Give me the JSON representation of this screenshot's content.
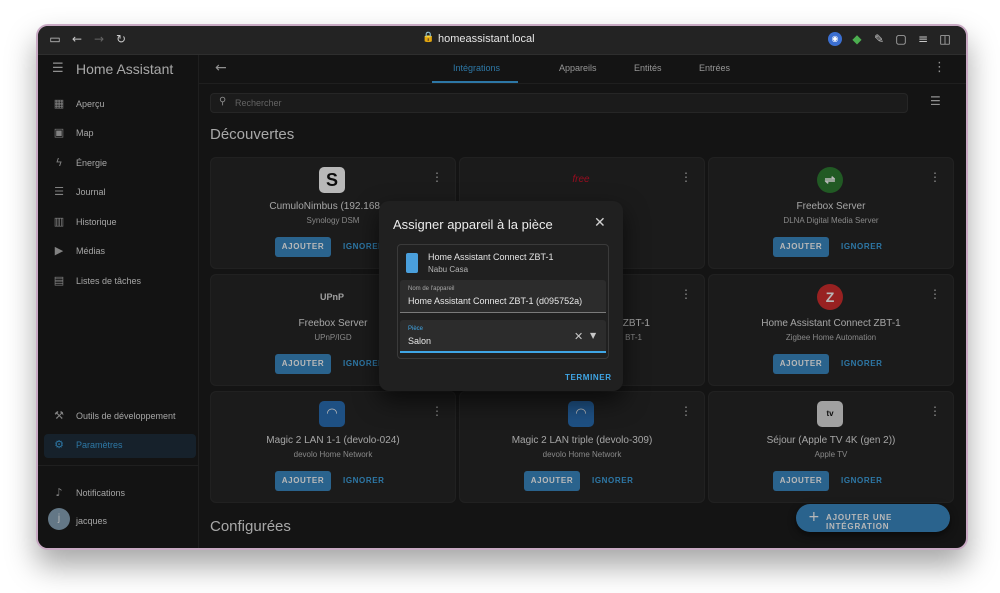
{
  "browser": {
    "url": "homeassistant.local"
  },
  "sidebar": {
    "title": "Home Assistant",
    "items": [
      {
        "label": "Aperçu",
        "icon": "dashboard-icon"
      },
      {
        "label": "Map",
        "icon": "map-icon"
      },
      {
        "label": "Énergie",
        "icon": "lightning-icon"
      },
      {
        "label": "Journal",
        "icon": "list-icon"
      },
      {
        "label": "Historique",
        "icon": "chart-icon"
      },
      {
        "label": "Médias",
        "icon": "media-icon"
      },
      {
        "label": "Listes de tâches",
        "icon": "clipboard-icon"
      }
    ],
    "bottom_items": [
      {
        "label": "Outils de développement",
        "icon": "hammer-icon"
      },
      {
        "label": "Paramètres",
        "icon": "gear-icon",
        "active": true
      }
    ],
    "notifications": "Notifications",
    "user": "jacques",
    "user_initial": "j"
  },
  "topbar": {
    "tabs": [
      "Intégrations",
      "Appareils",
      "Entités",
      "Entrées"
    ],
    "active_tab": "Intégrations"
  },
  "search": {
    "placeholder": "Rechercher"
  },
  "sections": {
    "discovered": "Découvertes",
    "configured": "Configurées"
  },
  "buttons": {
    "add": "AJOUTER",
    "ignore": "IGNORER",
    "add_integration": "AJOUTER UNE INTÉGRATION"
  },
  "cards": [
    {
      "name": "CumuloNimbus (192.168.1.1",
      "sub": "Synology DSM",
      "logo": "S"
    },
    {
      "name": "",
      "sub": "",
      "logo": "free"
    },
    {
      "name": "Freebox Server",
      "sub": "DLNA Digital Media Server",
      "logo": "⇌"
    },
    {
      "name": "Freebox Server",
      "sub": "UPnP/IGD",
      "logo": "UPnP"
    },
    {
      "name": "ZBT-1",
      "sub": "BT-1",
      "logo": ""
    },
    {
      "name": "Home Assistant Connect ZBT-1",
      "sub": "Zigbee Home Automation",
      "logo": "Z"
    },
    {
      "name": "Magic 2 LAN 1-1 (devolo-024)",
      "sub": "devolo Home Network",
      "logo": "wifi"
    },
    {
      "name": "Magic 2 LAN triple (devolo-309)",
      "sub": "devolo Home Network",
      "logo": "wifi"
    },
    {
      "name": "Séjour (Apple TV 4K (gen 2))",
      "sub": "Apple TV",
      "logo": "tv"
    }
  ],
  "dialog": {
    "title": "Assigner appareil à la pièce",
    "device_name": "Home Assistant Connect ZBT-1",
    "device_manufacturer": "Nabu Casa",
    "name_label": "Nom de l'appareil",
    "name_value": "Home Assistant Connect ZBT-1 (d095752a)",
    "room_label": "Pièce",
    "room_value": "Salon",
    "finish": "TERMINER"
  },
  "colors": {
    "accent": "#3fa6e6",
    "button": "#3b8ac4",
    "background": "#1c1c1c",
    "card": "#262626"
  }
}
